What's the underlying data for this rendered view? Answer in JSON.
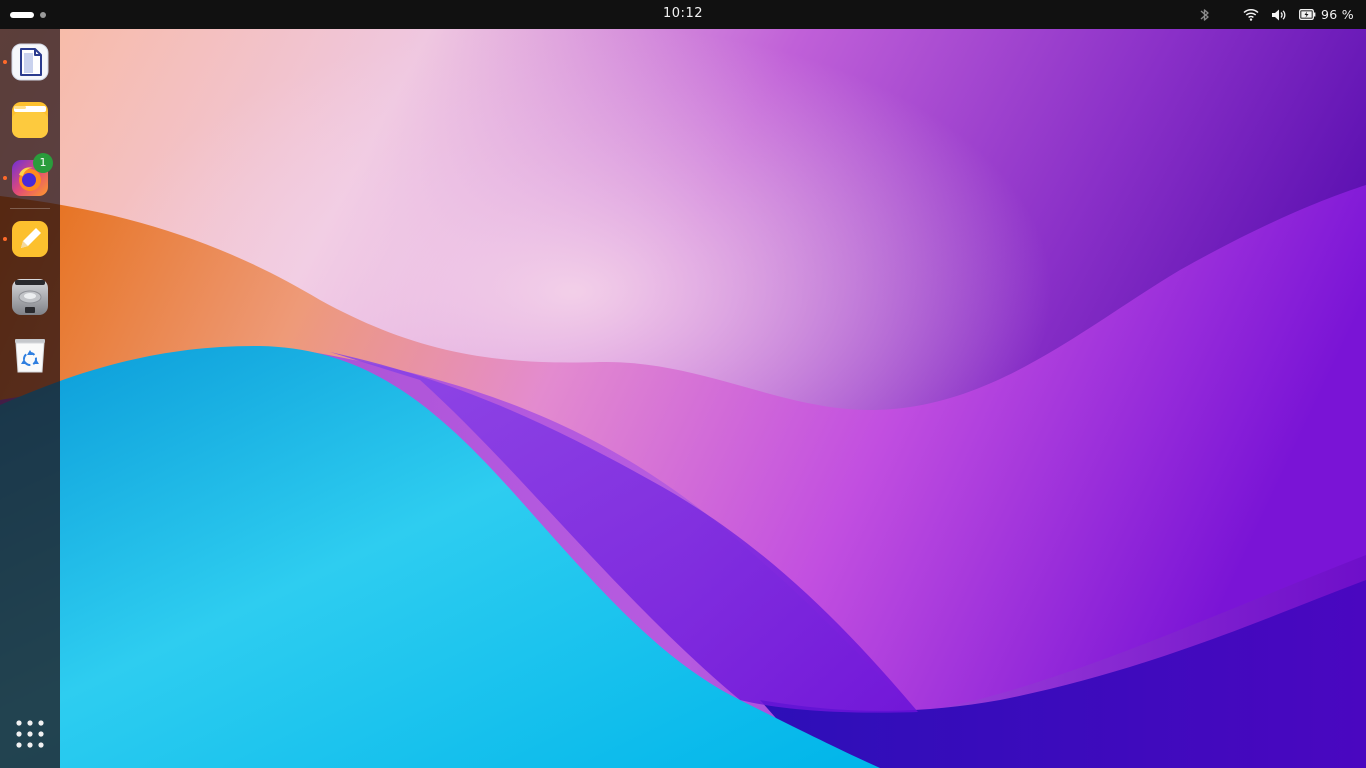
{
  "topbar": {
    "clock": "10:12",
    "battery_percent": "96 %",
    "icons": [
      "activities-workspace-indicator",
      "bluetooth-icon",
      "wifi-icon",
      "volume-icon",
      "battery-icon"
    ]
  },
  "dock": {
    "items": [
      {
        "name": "text-editor",
        "icon": "document-icon",
        "running": true
      },
      {
        "name": "files",
        "icon": "folder-icon",
        "running": false
      },
      {
        "name": "firefox",
        "icon": "firefox-icon",
        "running": true,
        "badge": "1"
      },
      {
        "name": "notes",
        "icon": "pencil-notes-icon",
        "running": true
      },
      {
        "name": "disk",
        "icon": "hard-drive-icon",
        "running": false
      },
      {
        "name": "trash",
        "icon": "recycle-bin-icon",
        "running": false
      }
    ],
    "show_apps_icon": "app-grid-icon"
  },
  "colors": {
    "topbar": "#111111",
    "running_indicator": "#ff6a2a",
    "badge": "#2a9c3c"
  }
}
